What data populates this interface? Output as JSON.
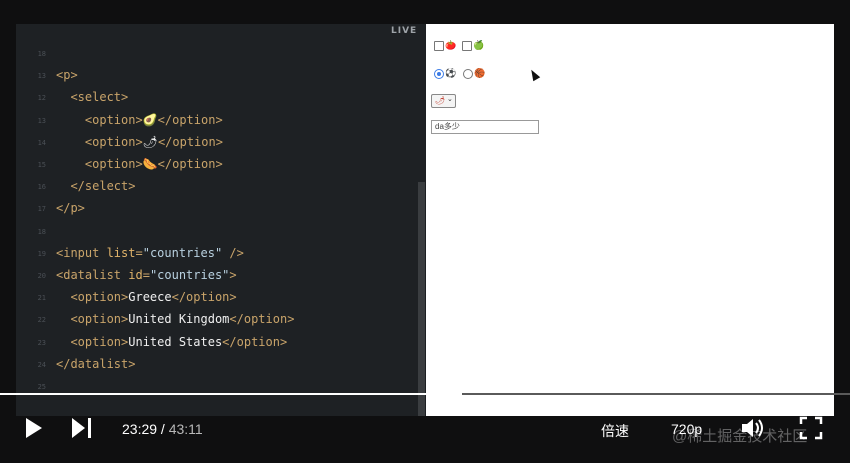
{
  "editor": {
    "live_label": "LIVE",
    "line_numbers": [
      "18",
      "13",
      "12",
      "13",
      "14",
      "15",
      "16",
      "17",
      "18",
      "19",
      "20",
      "21",
      "22",
      "23",
      "24",
      "25"
    ],
    "lines": [
      {
        "indent": "",
        "parts": []
      },
      {
        "indent": "",
        "parts": [
          {
            "c": "tag",
            "t": "<p>"
          }
        ]
      },
      {
        "indent": "  ",
        "parts": [
          {
            "c": "tag",
            "t": "<select>"
          }
        ]
      },
      {
        "indent": "    ",
        "parts": [
          {
            "c": "tag",
            "t": "<option>"
          },
          {
            "c": "txt",
            "t": "🥑"
          },
          {
            "c": "tag",
            "t": "</option>"
          }
        ]
      },
      {
        "indent": "    ",
        "parts": [
          {
            "c": "tag",
            "t": "<option>"
          },
          {
            "c": "txt",
            "t": "🌶"
          },
          {
            "c": "tag",
            "t": "</option>"
          }
        ]
      },
      {
        "indent": "    ",
        "parts": [
          {
            "c": "tag",
            "t": "<option>"
          },
          {
            "c": "txt",
            "t": "🌭"
          },
          {
            "c": "tag",
            "t": "</option>"
          }
        ]
      },
      {
        "indent": "  ",
        "parts": [
          {
            "c": "tag",
            "t": "</select>"
          }
        ]
      },
      {
        "indent": "",
        "parts": [
          {
            "c": "tag",
            "t": "</p>"
          }
        ]
      },
      {
        "indent": "",
        "parts": []
      },
      {
        "indent": "",
        "parts": [
          {
            "c": "tag",
            "t": "<input "
          },
          {
            "c": "attr",
            "t": "list"
          },
          {
            "c": "tag",
            "t": "="
          },
          {
            "c": "str",
            "t": "\"countries\""
          },
          {
            "c": "tag",
            "t": " />"
          }
        ]
      },
      {
        "indent": "",
        "parts": [
          {
            "c": "tag",
            "t": "<datalist "
          },
          {
            "c": "attr",
            "t": "id"
          },
          {
            "c": "tag",
            "t": "="
          },
          {
            "c": "str",
            "t": "\"countries\""
          },
          {
            "c": "tag",
            "t": ">"
          }
        ]
      },
      {
        "indent": "  ",
        "parts": [
          {
            "c": "tag",
            "t": "<option>"
          },
          {
            "c": "txt",
            "t": "Greece"
          },
          {
            "c": "tag",
            "t": "</option>"
          }
        ]
      },
      {
        "indent": "  ",
        "parts": [
          {
            "c": "tag",
            "t": "<option>"
          },
          {
            "c": "txt",
            "t": "United Kingdom"
          },
          {
            "c": "tag",
            "t": "</option>"
          }
        ]
      },
      {
        "indent": "  ",
        "parts": [
          {
            "c": "tag",
            "t": "<option>"
          },
          {
            "c": "txt",
            "t": "United States"
          },
          {
            "c": "tag",
            "t": "</option>"
          }
        ]
      },
      {
        "indent": "",
        "parts": [
          {
            "c": "tag",
            "t": "</datalist>"
          }
        ]
      },
      {
        "indent": "",
        "parts": []
      }
    ]
  },
  "preview": {
    "checkbox_emojis": [
      "🍅",
      "🍏"
    ],
    "radio_emojis": [
      "⚽",
      "🏀"
    ],
    "radio_checked_index": 0,
    "select_value": "🌶",
    "input_value": "da多少"
  },
  "player": {
    "current_time": "23:29",
    "separator": " / ",
    "duration": "43:11",
    "progress_fraction": 0.544,
    "speed_label": "倍速",
    "quality_label": "720p",
    "watermark": "@稀土掘金技术社区"
  },
  "colors": {
    "accent": "#3b7be6",
    "tag": "#c9a46a",
    "attr": "#e0b36a",
    "string": "#b9d1e0"
  }
}
